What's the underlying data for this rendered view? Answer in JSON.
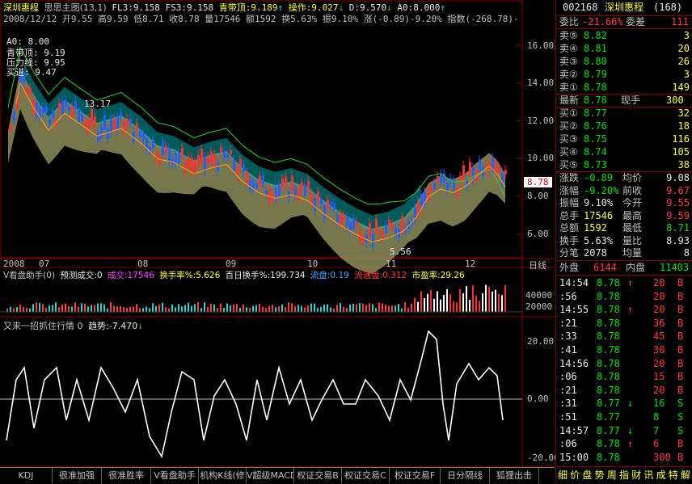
{
  "header": {
    "stock_name": "深圳惠程",
    "indicator_name": "思思主图(13,1)",
    "fl3": "FL3:9.158",
    "fs3": "FS3:9.158",
    "qingdai": "青带顶:9.189",
    "caozuo": "操作:9.027",
    "d_val": "D:9.570",
    "a0_val": "A0:8.000",
    "line2": "2008/12/12 开9.55 高9.59 低8.71 收8.78 量17546 额1592 换5.63% 振9.10% 涨(-0.89)-9.20% 指数(-268.78)-"
  },
  "overlay_labels": {
    "a0": "A0: 8.00",
    "qingdai": "青带顶: 9.19",
    "yaliwei": "压力线: 9.95",
    "maiyu": "买进: 9.47",
    "peak_label": "13.17",
    "low_label": "5.56"
  },
  "price_axis": [
    "16.00",
    "14.00",
    "12.00",
    "10.00",
    "8.00",
    "6.00"
  ],
  "price_tag": "8.78",
  "time_axis": [
    "2008",
    "07",
    "08",
    "09",
    "10",
    "11",
    "12"
  ],
  "period_label": "日线",
  "volume_header": {
    "name": "V看盘助手(0)",
    "yuce": "预测成交:0",
    "chengjiao": "成交:17546",
    "huanshou": "换手率%:5.626",
    "baihuan": "百日换手%:199.734",
    "liupan": "流盘:0.19",
    "liutong": "流通盘:0.312",
    "shiying": "市盈率:29.26"
  },
  "volume_axis": [
    "40000",
    "20000"
  ],
  "osc_header": {
    "name": "又来一招抓住行情 0",
    "trend": "趋势:-7.470"
  },
  "osc_axis": [
    "20.00",
    "0.00",
    "-20.00"
  ],
  "tabs": [
    "KDJ",
    "很准加强",
    "很准胜率",
    "V看盘助手",
    "机构K线(修",
    "V超级MACD",
    "权证交易B",
    "权证交易C",
    "权证交易F",
    "日分隔线",
    "狐狸出击"
  ],
  "quote": {
    "code": "002168",
    "name": "深圳惠程",
    "count": "(168)",
    "weibi_label": "委比",
    "weibi_val": "-21.66%",
    "weicha_label": "委差",
    "weicha_val": "111",
    "sells": [
      {
        "label": "卖⑤",
        "price": "8.82",
        "vol": "3"
      },
      {
        "label": "卖④",
        "price": "8.81",
        "vol": "20"
      },
      {
        "label": "卖③",
        "price": "8.80",
        "vol": "26"
      },
      {
        "label": "卖②",
        "price": "8.79",
        "vol": "3"
      },
      {
        "label": "卖①",
        "price": "8.78",
        "vol": "149"
      }
    ],
    "latest_label": "最新",
    "latest_val": "8.78",
    "xianshou_label": "现手",
    "xianshou_val": "300",
    "buys": [
      {
        "label": "买①",
        "price": "8.77",
        "vol": "32"
      },
      {
        "label": "买②",
        "price": "8.76",
        "vol": "18"
      },
      {
        "label": "买③",
        "price": "8.75",
        "vol": "116"
      },
      {
        "label": "买④",
        "price": "8.74",
        "vol": "105"
      },
      {
        "label": "买⑤",
        "price": "8.73",
        "vol": "38"
      }
    ],
    "stats": [
      {
        "l1": "涨跌",
        "v1": "-0.89",
        "l2": "均价",
        "v2": "9.08"
      },
      {
        "l1": "涨幅",
        "v1": "-9.20%",
        "l2": "前收",
        "v2": "9.67"
      },
      {
        "l1": "振幅",
        "v1": "9.10%",
        "l2": "今开",
        "v2": "9.55"
      },
      {
        "l1": "总手",
        "v1": "17546",
        "l2": "最高",
        "v2": "9.59"
      },
      {
        "l1": "总额",
        "v1": "1592",
        "l2": "最低",
        "v2": "8.71"
      },
      {
        "l1": "换手",
        "v1": "5.63%",
        "l2": "量比",
        "v2": "8.93"
      },
      {
        "l1": "分笔",
        "v1": "2078",
        "l2": "均量",
        "v2": "8"
      }
    ],
    "waipan_label": "外盘",
    "waipan_val": "6144",
    "neipan_label": "内盘",
    "neipan_val": "11403",
    "ticks": [
      {
        "time": "14:54",
        "price": "8.78",
        "arrow": "↑",
        "vol": "20",
        "side": "B"
      },
      {
        "time": ":56",
        "price": "8.78",
        "arrow": "",
        "vol": "20",
        "side": "B"
      },
      {
        "time": "14:55",
        "price": "8.78",
        "arrow": "↑",
        "vol": "20",
        "side": "B"
      },
      {
        "time": ":21",
        "price": "8.78",
        "arrow": "",
        "vol": "36",
        "side": "B"
      },
      {
        "time": ":33",
        "price": "8.78",
        "arrow": "",
        "vol": "45",
        "side": "B"
      },
      {
        "time": ":41",
        "price": "8.78",
        "arrow": "",
        "vol": "30",
        "side": "B"
      },
      {
        "time": "14:56",
        "price": "8.78",
        "arrow": "",
        "vol": "20",
        "side": "B"
      },
      {
        "time": ":06",
        "price": "8.78",
        "arrow": "",
        "vol": "15",
        "side": "B"
      },
      {
        "time": ":21",
        "price": "8.78",
        "arrow": "",
        "vol": "20",
        "side": "B"
      },
      {
        "time": ":31",
        "price": "8.77",
        "arrow": "↓",
        "vol": "16",
        "side": "S"
      },
      {
        "time": ":51",
        "price": "8.77",
        "arrow": "",
        "vol": "8",
        "side": "S"
      },
      {
        "time": "14:57",
        "price": "8.77",
        "arrow": "↓",
        "vol": "7",
        "side": "S"
      },
      {
        "time": ":06",
        "price": "8.78",
        "arrow": "↑",
        "vol": "6",
        "side": "B"
      },
      {
        "time": "15:00",
        "price": "8.78",
        "arrow": "",
        "vol": "300",
        "side": "B"
      }
    ],
    "bottom_tabs": [
      "细",
      "价",
      "盘",
      "势",
      "周",
      "指",
      "财",
      "讯",
      "成",
      "特",
      "解"
    ]
  },
  "colors": {
    "up": "#ff3c3c",
    "down": "#00e000",
    "frame": "#800000",
    "bg": "#000000"
  }
}
